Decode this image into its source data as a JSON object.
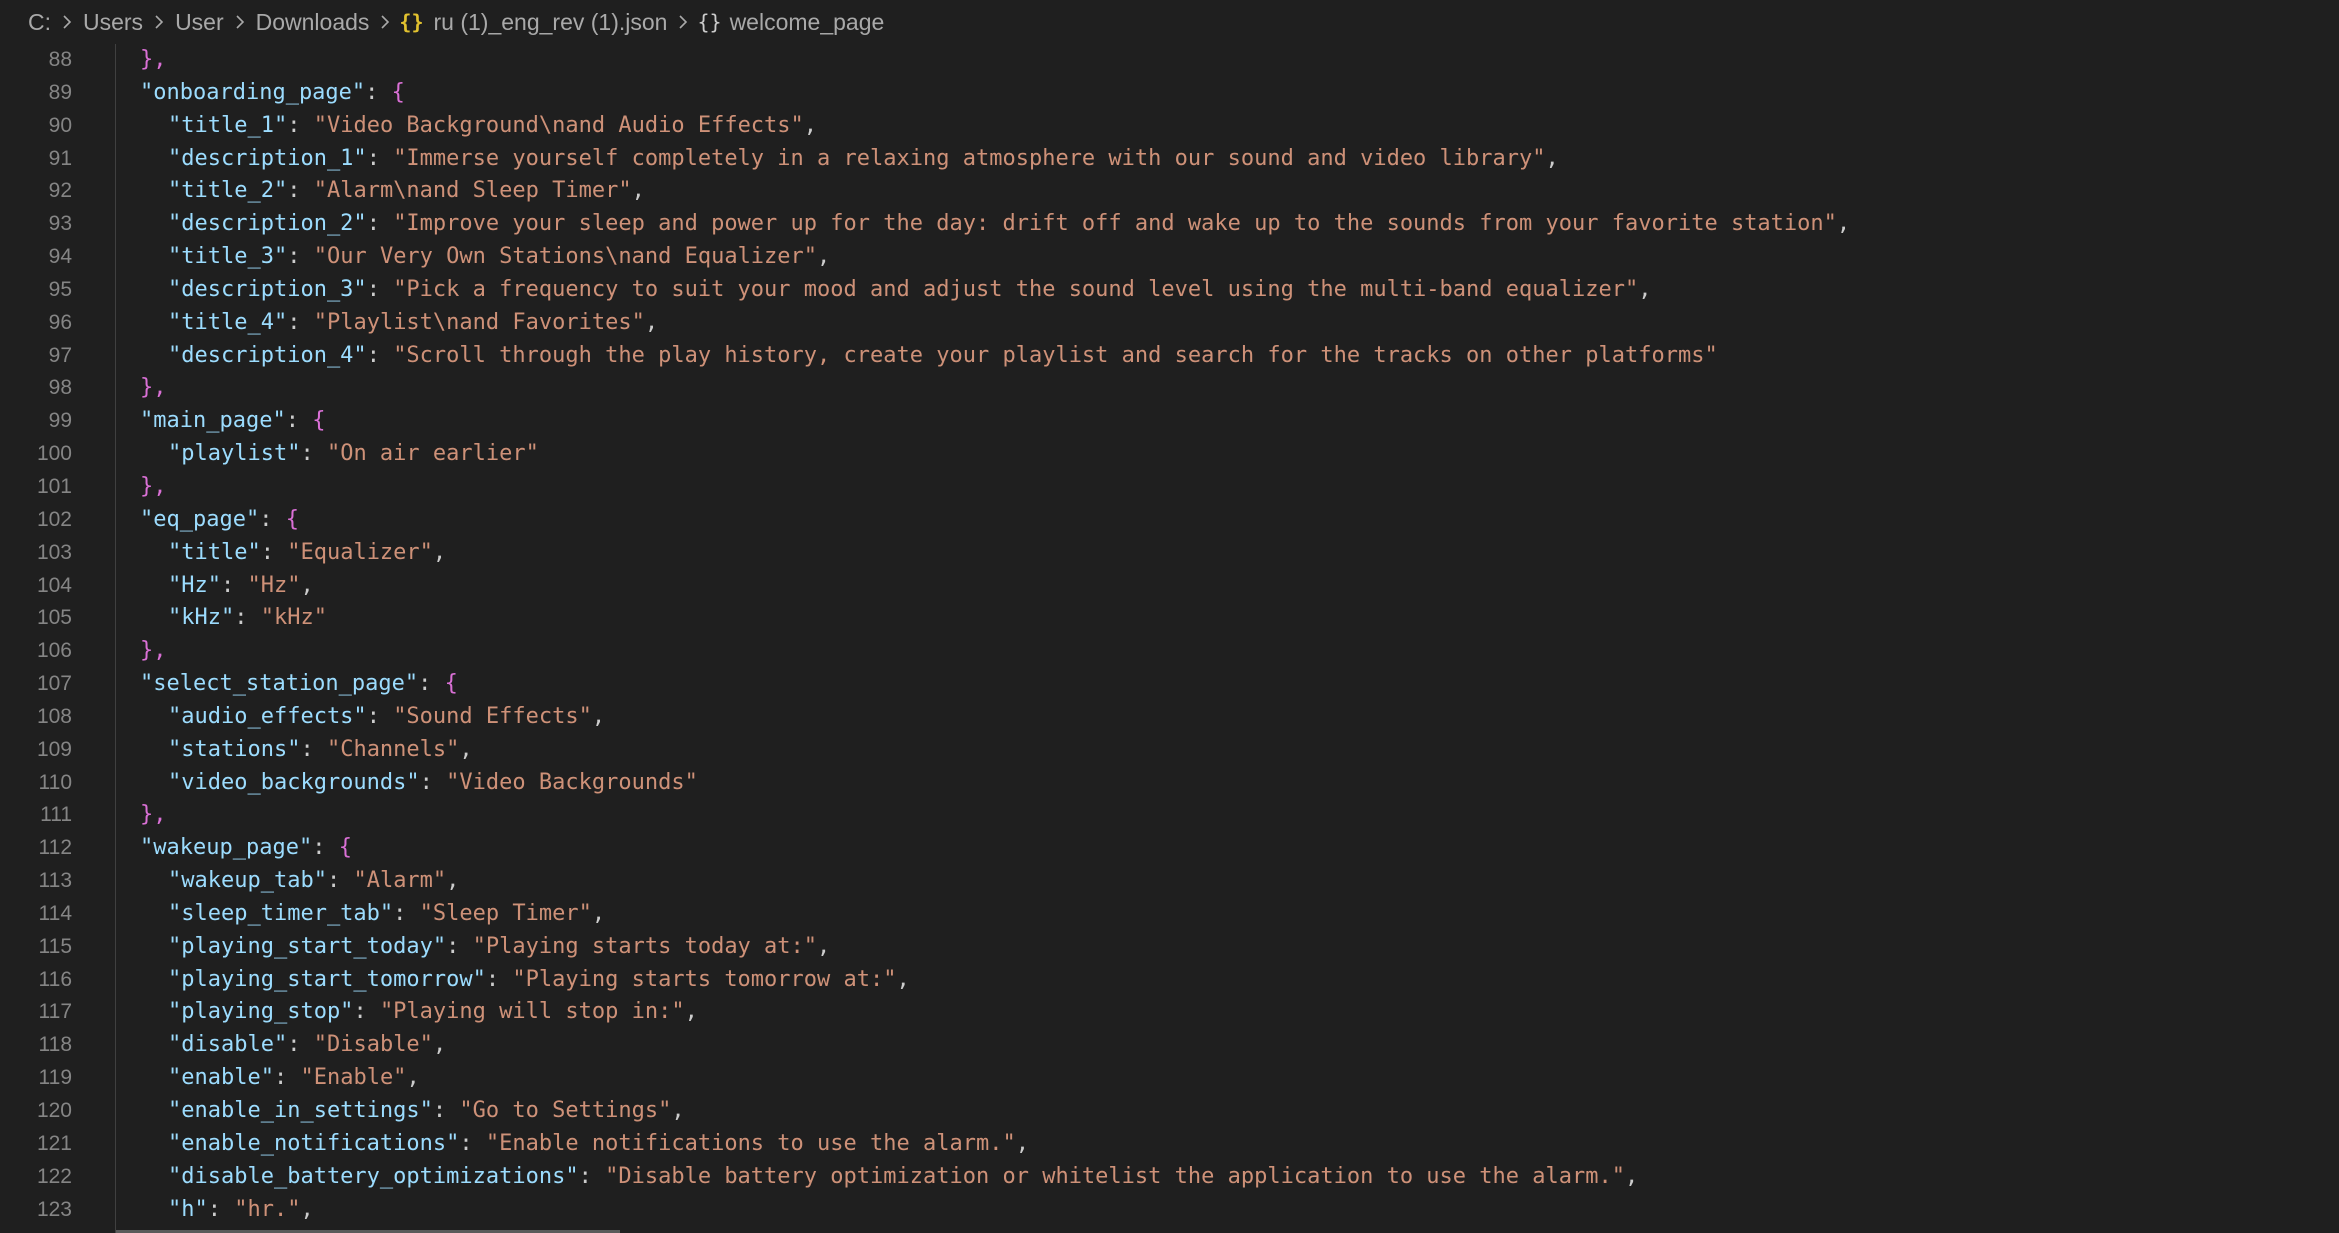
{
  "breadcrumb": {
    "items": [
      "C:",
      "Users",
      "User",
      "Downloads"
    ],
    "file": "ru (1)_eng_rev (1).json",
    "file_icon": "{}",
    "symbol": "welcome_page",
    "symbol_icon": "{}"
  },
  "editor": {
    "lines": [
      {
        "n": "88",
        "parts": [
          {
            "t": "},",
            "c": "b1"
          }
        ],
        "indent": 0
      },
      {
        "n": "89",
        "parts": [
          {
            "t": "\"onboarding_page\"",
            "c": "k"
          },
          {
            "t": ": ",
            "c": "p"
          },
          {
            "t": "{",
            "c": "b1"
          }
        ],
        "indent": 0
      },
      {
        "n": "90",
        "parts": [
          {
            "t": "\"title_1\"",
            "c": "k"
          },
          {
            "t": ": ",
            "c": "p"
          },
          {
            "t": "\"Video Background\\nand Audio Effects\"",
            "c": "s"
          },
          {
            "t": ",",
            "c": "p"
          }
        ],
        "indent": 1
      },
      {
        "n": "91",
        "parts": [
          {
            "t": "\"description_1\"",
            "c": "k"
          },
          {
            "t": ": ",
            "c": "p"
          },
          {
            "t": "\"Immerse yourself completely in a relaxing atmosphere with our sound and video library\"",
            "c": "s"
          },
          {
            "t": ",",
            "c": "p"
          }
        ],
        "indent": 1
      },
      {
        "n": "92",
        "parts": [
          {
            "t": "\"title_2\"",
            "c": "k"
          },
          {
            "t": ": ",
            "c": "p"
          },
          {
            "t": "\"Alarm\\nand Sleep Timer\"",
            "c": "s"
          },
          {
            "t": ",",
            "c": "p"
          }
        ],
        "indent": 1
      },
      {
        "n": "93",
        "parts": [
          {
            "t": "\"description_2\"",
            "c": "k"
          },
          {
            "t": ": ",
            "c": "p"
          },
          {
            "t": "\"Improve your sleep and power up for the day: drift off and wake up to the sounds from your favorite station\"",
            "c": "s"
          },
          {
            "t": ",",
            "c": "p"
          }
        ],
        "indent": 1
      },
      {
        "n": "94",
        "parts": [
          {
            "t": "\"title_3\"",
            "c": "k"
          },
          {
            "t": ": ",
            "c": "p"
          },
          {
            "t": "\"Our Very Own Stations\\nand Equalizer\"",
            "c": "s"
          },
          {
            "t": ",",
            "c": "p"
          }
        ],
        "indent": 1
      },
      {
        "n": "95",
        "parts": [
          {
            "t": "\"description_3\"",
            "c": "k"
          },
          {
            "t": ": ",
            "c": "p"
          },
          {
            "t": "\"Pick a frequency to suit your mood and adjust the sound level using the multi-band equalizer\"",
            "c": "s"
          },
          {
            "t": ",",
            "c": "p"
          }
        ],
        "indent": 1
      },
      {
        "n": "96",
        "parts": [
          {
            "t": "\"title_4\"",
            "c": "k"
          },
          {
            "t": ": ",
            "c": "p"
          },
          {
            "t": "\"Playlist\\nand Favorites\"",
            "c": "s"
          },
          {
            "t": ",",
            "c": "p"
          }
        ],
        "indent": 1
      },
      {
        "n": "97",
        "parts": [
          {
            "t": "\"description_4\"",
            "c": "k"
          },
          {
            "t": ": ",
            "c": "p"
          },
          {
            "t": "\"Scroll through the play history, create your playlist and search for the tracks on other platforms\"",
            "c": "s"
          }
        ],
        "indent": 1
      },
      {
        "n": "98",
        "parts": [
          {
            "t": "},",
            "c": "b1"
          }
        ],
        "indent": 0
      },
      {
        "n": "99",
        "parts": [
          {
            "t": "\"main_page\"",
            "c": "k"
          },
          {
            "t": ": ",
            "c": "p"
          },
          {
            "t": "{",
            "c": "b1"
          }
        ],
        "indent": 0
      },
      {
        "n": "100",
        "parts": [
          {
            "t": "\"playlist\"",
            "c": "k"
          },
          {
            "t": ": ",
            "c": "p"
          },
          {
            "t": "\"On air earlier\"",
            "c": "s"
          }
        ],
        "indent": 1
      },
      {
        "n": "101",
        "parts": [
          {
            "t": "},",
            "c": "b1"
          }
        ],
        "indent": 0
      },
      {
        "n": "102",
        "parts": [
          {
            "t": "\"eq_page\"",
            "c": "k"
          },
          {
            "t": ": ",
            "c": "p"
          },
          {
            "t": "{",
            "c": "b1"
          }
        ],
        "indent": 0
      },
      {
        "n": "103",
        "parts": [
          {
            "t": "\"title\"",
            "c": "k"
          },
          {
            "t": ": ",
            "c": "p"
          },
          {
            "t": "\"Equalizer\"",
            "c": "s"
          },
          {
            "t": ",",
            "c": "p"
          }
        ],
        "indent": 1
      },
      {
        "n": "104",
        "parts": [
          {
            "t": "\"Hz\"",
            "c": "k"
          },
          {
            "t": ": ",
            "c": "p"
          },
          {
            "t": "\"Hz\"",
            "c": "s"
          },
          {
            "t": ",",
            "c": "p"
          }
        ],
        "indent": 1
      },
      {
        "n": "105",
        "parts": [
          {
            "t": "\"kHz\"",
            "c": "k"
          },
          {
            "t": ": ",
            "c": "p"
          },
          {
            "t": "\"kHz\"",
            "c": "s"
          }
        ],
        "indent": 1
      },
      {
        "n": "106",
        "parts": [
          {
            "t": "},",
            "c": "b1"
          }
        ],
        "indent": 0
      },
      {
        "n": "107",
        "parts": [
          {
            "t": "\"select_station_page\"",
            "c": "k"
          },
          {
            "t": ": ",
            "c": "p"
          },
          {
            "t": "{",
            "c": "b1"
          }
        ],
        "indent": 0
      },
      {
        "n": "108",
        "parts": [
          {
            "t": "\"audio_effects\"",
            "c": "k"
          },
          {
            "t": ": ",
            "c": "p"
          },
          {
            "t": "\"Sound Effects\"",
            "c": "s"
          },
          {
            "t": ",",
            "c": "p"
          }
        ],
        "indent": 1
      },
      {
        "n": "109",
        "parts": [
          {
            "t": "\"stations\"",
            "c": "k"
          },
          {
            "t": ": ",
            "c": "p"
          },
          {
            "t": "\"Channels\"",
            "c": "s"
          },
          {
            "t": ",",
            "c": "p"
          }
        ],
        "indent": 1
      },
      {
        "n": "110",
        "parts": [
          {
            "t": "\"video_backgrounds\"",
            "c": "k"
          },
          {
            "t": ": ",
            "c": "p"
          },
          {
            "t": "\"Video Backgrounds\"",
            "c": "s"
          }
        ],
        "indent": 1
      },
      {
        "n": "111",
        "parts": [
          {
            "t": "},",
            "c": "b1"
          }
        ],
        "indent": 0
      },
      {
        "n": "112",
        "parts": [
          {
            "t": "\"wakeup_page\"",
            "c": "k"
          },
          {
            "t": ": ",
            "c": "p"
          },
          {
            "t": "{",
            "c": "b1"
          }
        ],
        "indent": 0
      },
      {
        "n": "113",
        "parts": [
          {
            "t": "\"wakeup_tab\"",
            "c": "k"
          },
          {
            "t": ": ",
            "c": "p"
          },
          {
            "t": "\"Alarm\"",
            "c": "s"
          },
          {
            "t": ",",
            "c": "p"
          }
        ],
        "indent": 1
      },
      {
        "n": "114",
        "parts": [
          {
            "t": "\"sleep_timer_tab\"",
            "c": "k"
          },
          {
            "t": ": ",
            "c": "p"
          },
          {
            "t": "\"Sleep Timer\"",
            "c": "s"
          },
          {
            "t": ",",
            "c": "p"
          }
        ],
        "indent": 1
      },
      {
        "n": "115",
        "parts": [
          {
            "t": "\"playing_start_today\"",
            "c": "k"
          },
          {
            "t": ": ",
            "c": "p"
          },
          {
            "t": "\"Playing starts today at:\"",
            "c": "s"
          },
          {
            "t": ",",
            "c": "p"
          }
        ],
        "indent": 1
      },
      {
        "n": "116",
        "parts": [
          {
            "t": "\"playing_start_tomorrow\"",
            "c": "k"
          },
          {
            "t": ": ",
            "c": "p"
          },
          {
            "t": "\"Playing starts tomorrow at:\"",
            "c": "s"
          },
          {
            "t": ",",
            "c": "p"
          }
        ],
        "indent": 1
      },
      {
        "n": "117",
        "parts": [
          {
            "t": "\"playing_stop\"",
            "c": "k"
          },
          {
            "t": ": ",
            "c": "p"
          },
          {
            "t": "\"Playing will stop in:\"",
            "c": "s"
          },
          {
            "t": ",",
            "c": "p"
          }
        ],
        "indent": 1
      },
      {
        "n": "118",
        "parts": [
          {
            "t": "\"disable\"",
            "c": "k"
          },
          {
            "t": ": ",
            "c": "p"
          },
          {
            "t": "\"Disable\"",
            "c": "s"
          },
          {
            "t": ",",
            "c": "p"
          }
        ],
        "indent": 1
      },
      {
        "n": "119",
        "parts": [
          {
            "t": "\"enable\"",
            "c": "k"
          },
          {
            "t": ": ",
            "c": "p"
          },
          {
            "t": "\"Enable\"",
            "c": "s"
          },
          {
            "t": ",",
            "c": "p"
          }
        ],
        "indent": 1
      },
      {
        "n": "120",
        "parts": [
          {
            "t": "\"enable_in_settings\"",
            "c": "k"
          },
          {
            "t": ": ",
            "c": "p"
          },
          {
            "t": "\"Go to Settings\"",
            "c": "s"
          },
          {
            "t": ",",
            "c": "p"
          }
        ],
        "indent": 1
      },
      {
        "n": "121",
        "parts": [
          {
            "t": "\"enable_notifications\"",
            "c": "k"
          },
          {
            "t": ": ",
            "c": "p"
          },
          {
            "t": "\"Enable notifications to use the alarm.\"",
            "c": "s"
          },
          {
            "t": ",",
            "c": "p"
          }
        ],
        "indent": 1
      },
      {
        "n": "122",
        "parts": [
          {
            "t": "\"disable_battery_optimizations\"",
            "c": "k"
          },
          {
            "t": ": ",
            "c": "p"
          },
          {
            "t": "\"Disable battery optimization or whitelist the application to use the alarm.\"",
            "c": "s"
          },
          {
            "t": ",",
            "c": "p"
          }
        ],
        "indent": 1
      },
      {
        "n": "123",
        "parts": [
          {
            "t": "\"h\"",
            "c": "k"
          },
          {
            "t": ": ",
            "c": "p"
          },
          {
            "t": "\"hr.\"",
            "c": "s"
          },
          {
            "t": ",",
            "c": "p"
          }
        ],
        "indent": 1
      }
    ]
  }
}
